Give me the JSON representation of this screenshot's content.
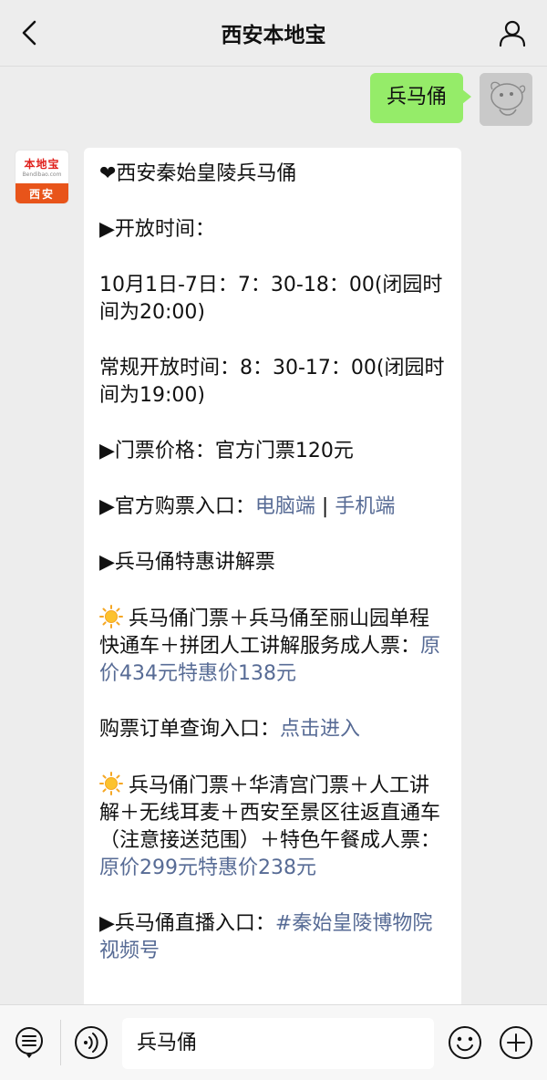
{
  "header": {
    "title": "西安本地宝"
  },
  "outgoing": {
    "text": "兵马俑"
  },
  "bot": {
    "logo_brand": "本地宝",
    "logo_sub": "Bendibao.com",
    "logo_city": "西安"
  },
  "message": {
    "title": "❤西安秦始皇陵兵马俑",
    "hours_heading": "▶开放时间：",
    "hours_holiday": "10月1日-7日：7：30-18：00(闭园时间为20:00)",
    "hours_regular": "常规开放时间：8：30-17：00(闭园时间为19:00)",
    "price": "▶门票价格：官方门票120元",
    "official_entry_label": "▶官方购票入口：",
    "official_entry_pc": "电脑端",
    "official_entry_sep": " | ",
    "official_entry_mobile": "手机端",
    "discount_heading": "▶兵马俑特惠讲解票",
    "offer1_text": "兵马俑门票＋兵马俑至丽山园单程快通车＋拼团人工讲解服务成人票：",
    "offer1_link": "原价434元特惠价138元",
    "order_label": "购票订单查询入口：",
    "order_link": "点击进入",
    "offer2_text": "兵马俑门票＋华清宫门票＋人工讲解＋无线耳麦＋西安至景区往返直通车（注意接送范围）＋特色午餐成人票：",
    "offer2_link": "原价299元特惠价238元",
    "live_label": "▶兵马俑直播入口：",
    "live_link": "#秦始皇陵博物院视频号"
  },
  "input": {
    "value": "兵马俑"
  },
  "icons": [
    "back-icon",
    "user-icon",
    "menu-list-icon",
    "voice-icon",
    "emoji-icon",
    "plus-icon",
    "sun-icon"
  ]
}
